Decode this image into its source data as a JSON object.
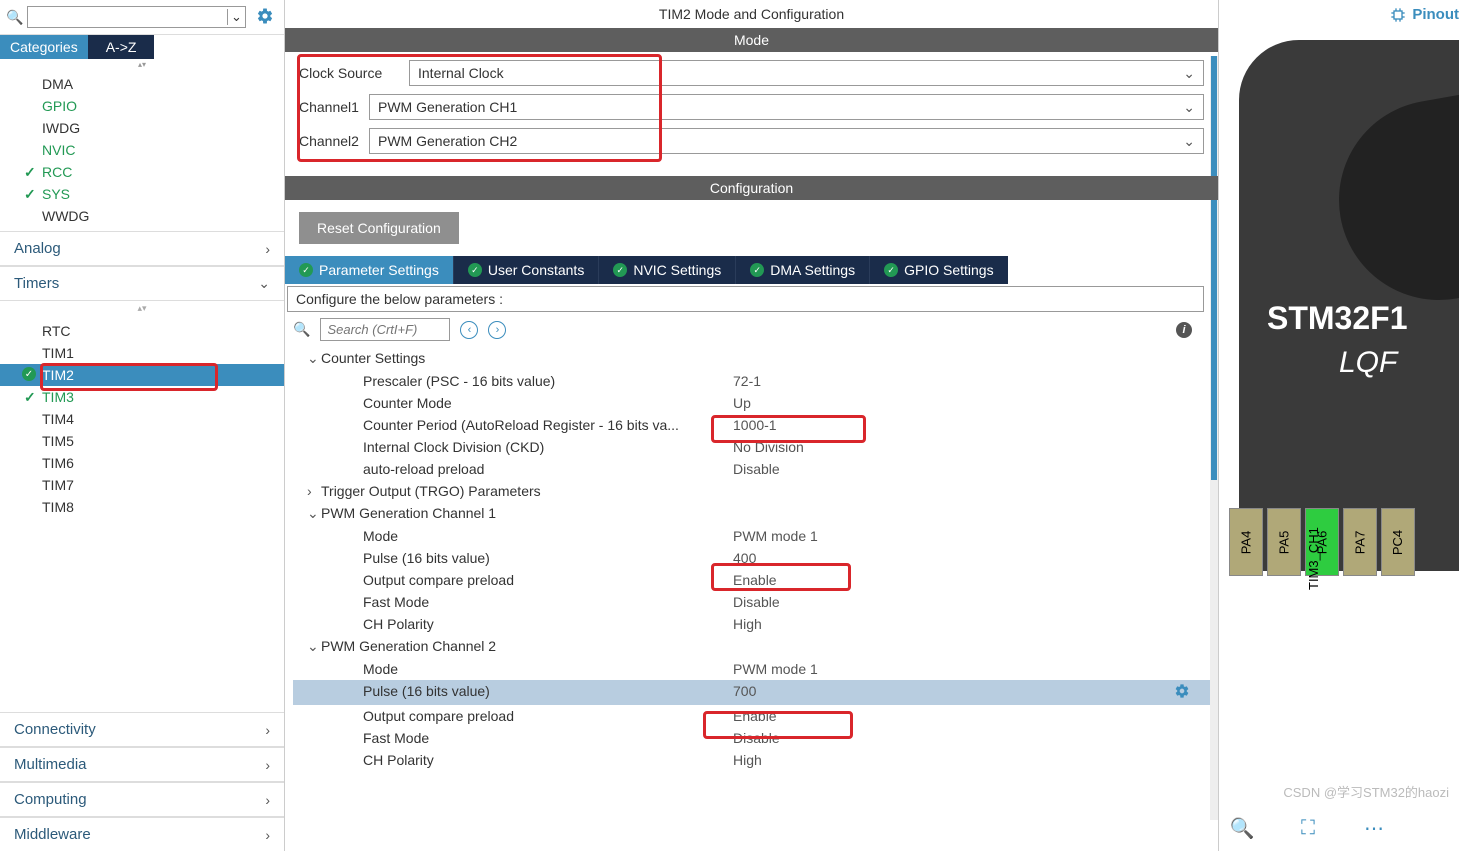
{
  "sidebar": {
    "tabs": {
      "categories": "Categories",
      "az": "A->Z"
    },
    "system_core_items": [
      {
        "label": "DMA",
        "cls": ""
      },
      {
        "label": "GPIO",
        "cls": "green"
      },
      {
        "label": "IWDG",
        "cls": ""
      },
      {
        "label": "NVIC",
        "cls": "green"
      },
      {
        "label": "RCC",
        "cls": "green check"
      },
      {
        "label": "SYS",
        "cls": "green check"
      },
      {
        "label": "WWDG",
        "cls": ""
      }
    ],
    "categories": [
      {
        "label": "Analog",
        "chev": "›"
      },
      {
        "label": "Timers",
        "chev": "⌄"
      }
    ],
    "timer_items": [
      {
        "label": "RTC",
        "cls": ""
      },
      {
        "label": "TIM1",
        "cls": ""
      },
      {
        "label": "TIM2",
        "cls": "selected checkcircle"
      },
      {
        "label": "TIM3",
        "cls": "green check"
      },
      {
        "label": "TIM4",
        "cls": ""
      },
      {
        "label": "TIM5",
        "cls": ""
      },
      {
        "label": "TIM6",
        "cls": ""
      },
      {
        "label": "TIM7",
        "cls": ""
      },
      {
        "label": "TIM8",
        "cls": ""
      }
    ],
    "bottom_categories": [
      {
        "label": "Connectivity",
        "chev": "›"
      },
      {
        "label": "Multimedia",
        "chev": "›"
      },
      {
        "label": "Computing",
        "chev": "›"
      },
      {
        "label": "Middleware",
        "chev": "›"
      }
    ]
  },
  "center": {
    "title": "TIM2 Mode and Configuration",
    "mode_header": "Mode",
    "mode_rows": [
      {
        "label": "Clock Source",
        "value": "Internal Clock"
      },
      {
        "label": "Channel1",
        "value": "PWM Generation CH1"
      },
      {
        "label": "Channel2",
        "value": "PWM Generation CH2"
      }
    ],
    "config_header": "Configuration",
    "reset_btn": "Reset Configuration",
    "cfg_tabs": [
      "Parameter Settings",
      "User Constants",
      "NVIC Settings",
      "DMA Settings",
      "GPIO Settings"
    ],
    "param_desc": "Configure the below parameters :",
    "search_placeholder": "Search (CrtI+F)",
    "groups": {
      "counter": {
        "title": "Counter Settings",
        "rows": [
          {
            "label": "Prescaler (PSC - 16 bits value)",
            "value": "72-1"
          },
          {
            "label": "Counter Mode",
            "value": "Up"
          },
          {
            "label": "Counter Period (AutoReload Register - 16 bits va...",
            "value": "1000-1"
          },
          {
            "label": "Internal Clock Division (CKD)",
            "value": "No Division"
          },
          {
            "label": "auto-reload preload",
            "value": "Disable"
          }
        ]
      },
      "trgo": {
        "title": "Trigger Output (TRGO) Parameters"
      },
      "pwm1": {
        "title": "PWM Generation Channel 1",
        "rows": [
          {
            "label": "Mode",
            "value": "PWM mode 1"
          },
          {
            "label": "Pulse (16 bits value)",
            "value": "400"
          },
          {
            "label": "Output compare preload",
            "value": "Enable"
          },
          {
            "label": "Fast Mode",
            "value": "Disable"
          },
          {
            "label": "CH Polarity",
            "value": "High"
          }
        ]
      },
      "pwm2": {
        "title": "PWM Generation Channel 2",
        "rows": [
          {
            "label": "Mode",
            "value": "PWM mode 1"
          },
          {
            "label": "Pulse (16 bits value)",
            "value": "700"
          },
          {
            "label": "Output compare preload",
            "value": "Enable"
          },
          {
            "label": "Fast Mode",
            "value": "Disable"
          },
          {
            "label": "CH Polarity",
            "value": "High"
          }
        ]
      }
    }
  },
  "right": {
    "pinout_label": "Pinout",
    "chip_name": "STM32F1",
    "chip_pkg": "LQF",
    "pins": [
      "PA4",
      "PA5",
      "PA6",
      "PA7",
      "PC4"
    ],
    "pin_func": "TIM3_CH1",
    "watermark": "CSDN @学习STM32的haozi"
  }
}
